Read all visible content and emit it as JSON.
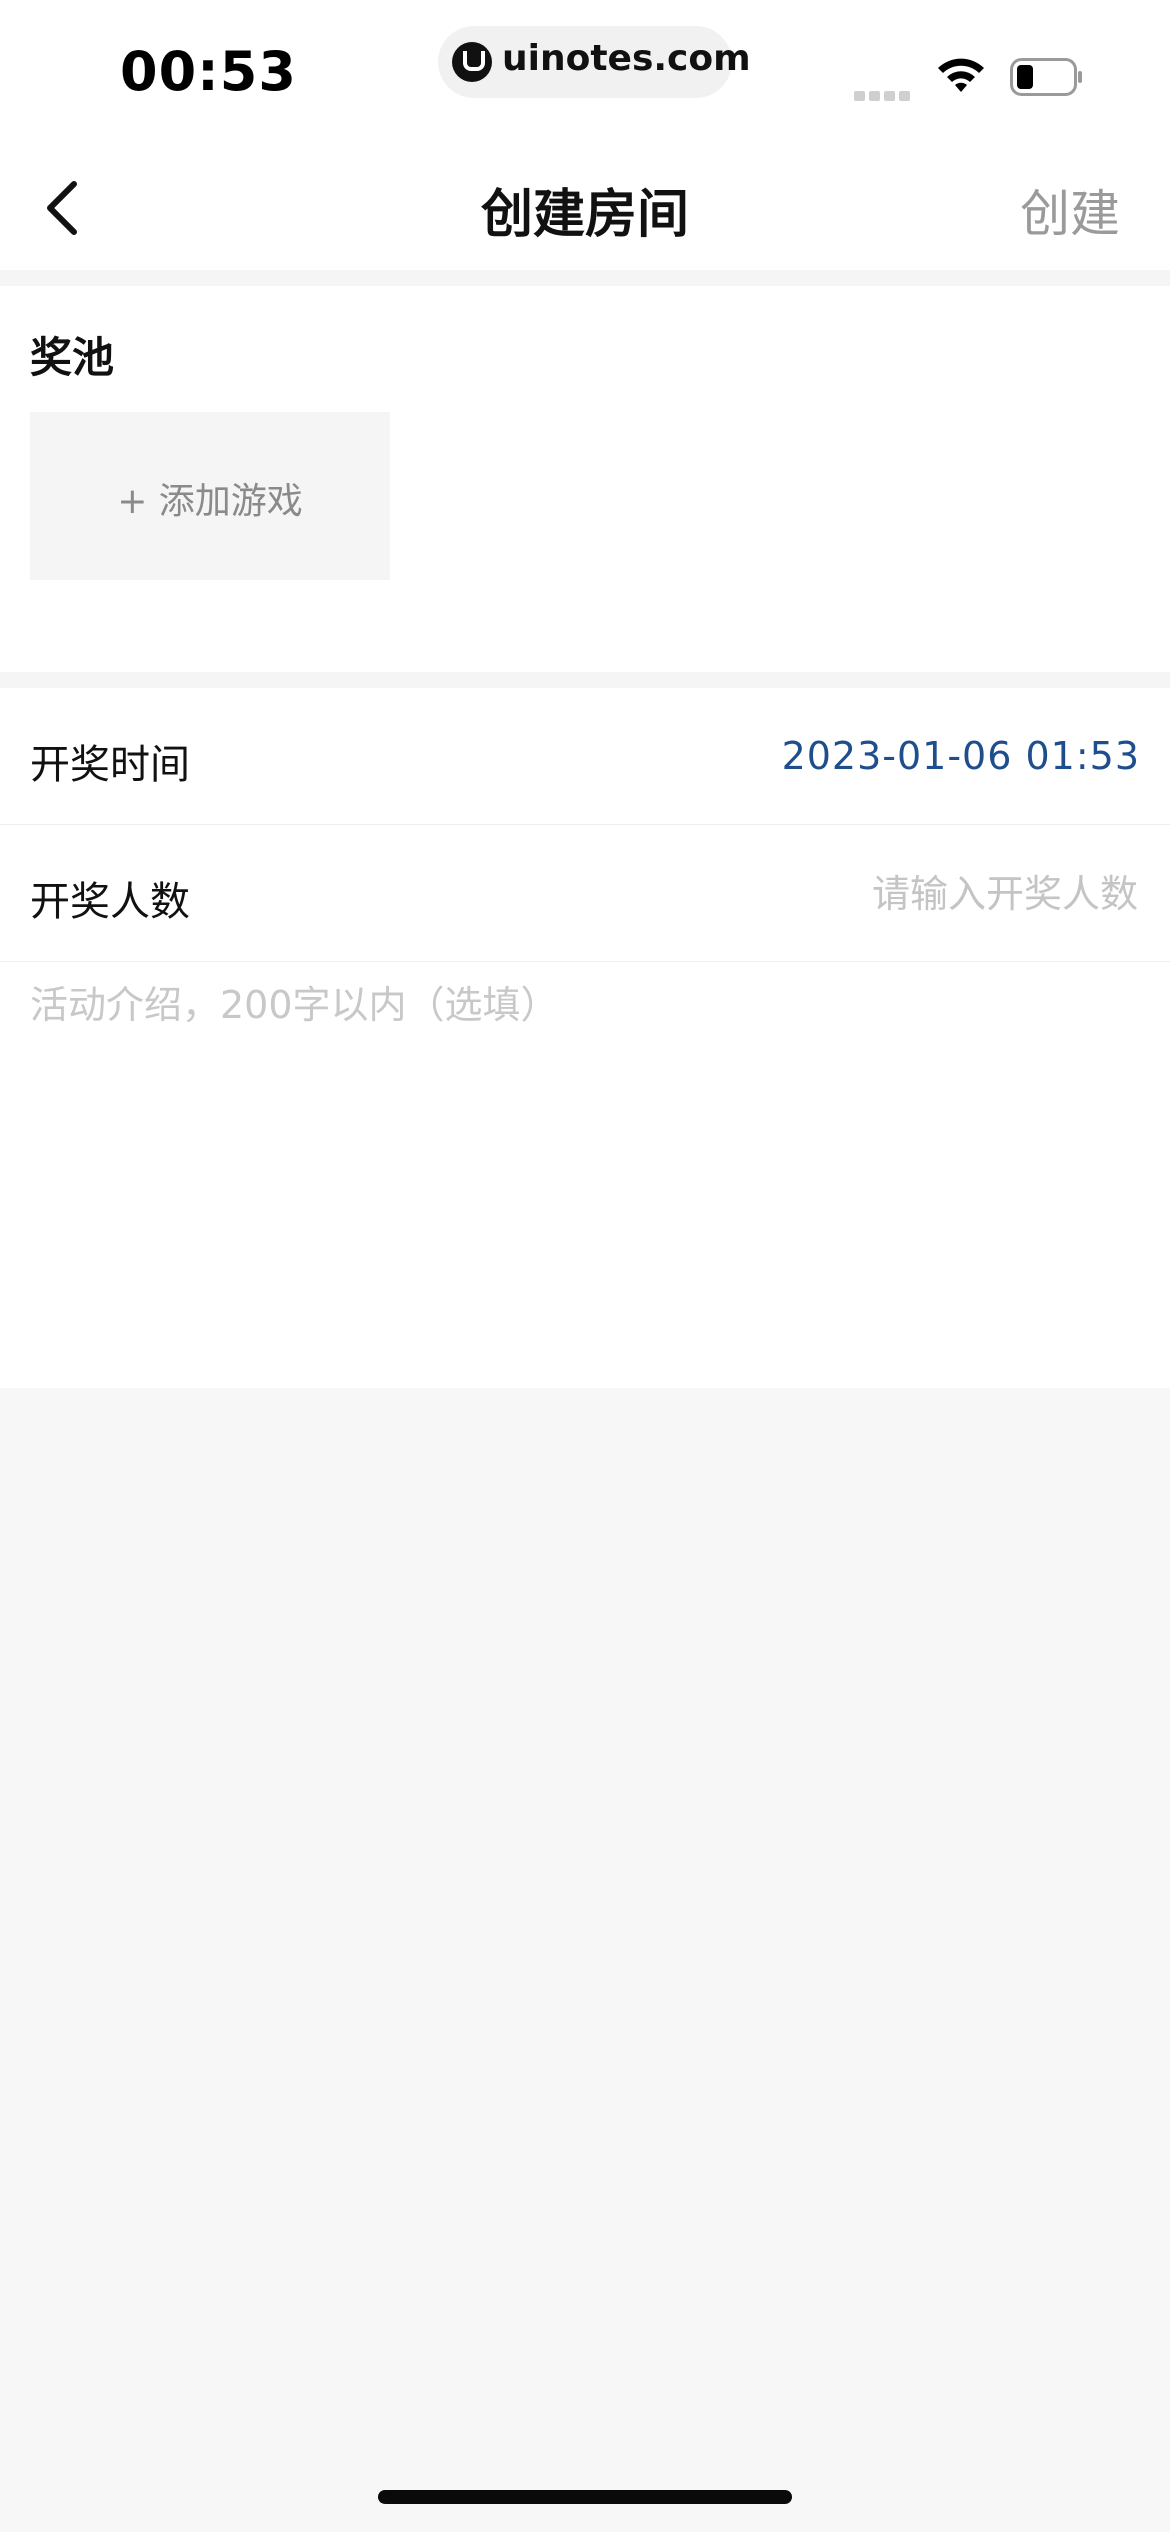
{
  "status_bar": {
    "time": "00:53",
    "url": "uinotes.com"
  },
  "header": {
    "title": "创建房间",
    "create_label": "创建"
  },
  "prize_pool": {
    "title": "奖池",
    "add_game_label": "+ 添加游戏"
  },
  "form": {
    "draw_time_label": "开奖时间",
    "draw_time_value": "2023-01-06 01:53",
    "winners_label": "开奖人数",
    "winners_placeholder": "请输入开奖人数",
    "intro_placeholder": "活动介绍，200字以内（选填）"
  },
  "colors": {
    "accent": "#1f4e8c",
    "placeholder": "#c4c4c4",
    "background": "#f7f7f7"
  },
  "icons": {
    "back": "chevron-left-icon",
    "wifi": "wifi-icon",
    "battery": "battery-icon",
    "site_logo": "uinotes-logo-icon"
  }
}
